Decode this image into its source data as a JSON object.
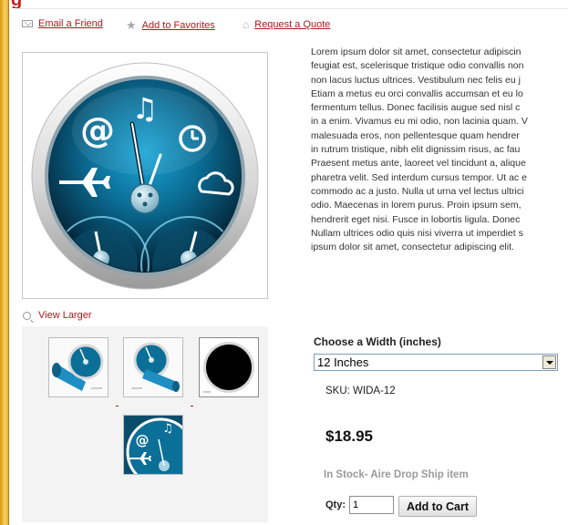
{
  "actions": {
    "email_friend": "Email a Friend",
    "add_favorites": "Add to Favorites",
    "request_quote": "Request a Quote"
  },
  "image": {
    "view_larger": "View Larger"
  },
  "description": [
    "Lorem ipsum dolor sit amet, consectetur adipiscin",
    "feugiat est, scelerisque tristique odio convallis non",
    "non lacus luctus ultrices. Vestibulum nec felis eu j",
    "Etiam a metus eu orci convallis accumsan et eu lo",
    "fermentum tellus. Donec facilisis augue sed nisl c",
    "in a enim. Vivamus eu mi odio, non lacinia quam. V",
    "malesuada eros, non pellentesque quam hendrer",
    "in rutrum tristique, nibh elit dignissim risus, ac fau",
    "Praesent metus ante, laoreet vel tincidunt a, alique",
    "pharetra velit. Sed interdum cursus tempor. Ut ac e",
    "commodo ac a justo. Nulla ut urna vel lectus ultrici",
    "odio. Maecenas in lorem purus. Proin ipsum sem,",
    "hendrerit eget nisi. Fusce in lobortis ligula. Donec",
    "Nullam ultrices odio quis nisi viverra ut imperdiet s",
    "ipsum dolor sit amet, consectetur adipiscing elit."
  ],
  "options": {
    "label": "Choose a Width (inches)",
    "selected": "12 Inches"
  },
  "sku": "SKU: WIDA-12",
  "price": "$18.95",
  "stock": "In Stock- Aire Drop Ship item",
  "cart": {
    "qty_label": "Qty:",
    "qty_value": "1",
    "button": "Add to Cart"
  },
  "colors": {
    "link": "#b3171d",
    "gauge_dark": "#05384f",
    "gauge_light": "#1aa6d6"
  }
}
